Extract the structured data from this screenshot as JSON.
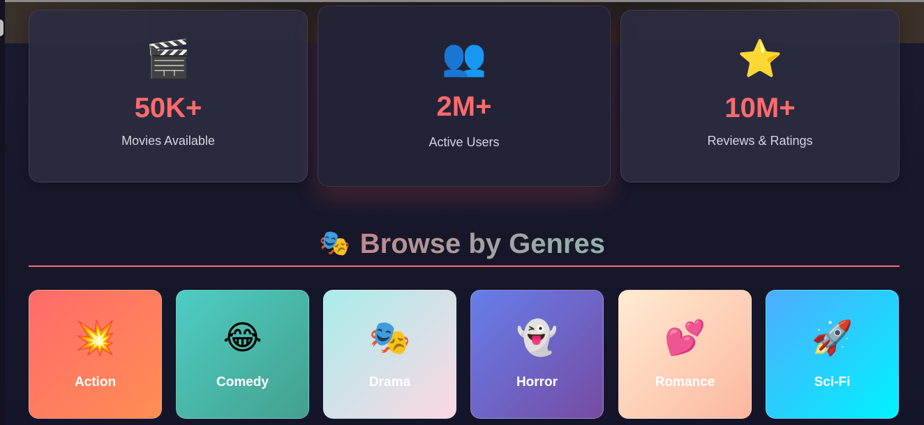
{
  "stats": [
    {
      "icon": "🎬",
      "icon_name": "clapper-board-icon",
      "value": "50K+",
      "label": "Movies Available"
    },
    {
      "icon": "👥",
      "icon_name": "users-icon",
      "value": "2M+",
      "label": "Active Users"
    },
    {
      "icon": "⭐",
      "icon_name": "star-icon",
      "value": "10M+",
      "label": "Reviews & Ratings"
    }
  ],
  "genres_section": {
    "icon": "🎭",
    "icon_name": "theater-masks-icon",
    "title": "Browse by Genres"
  },
  "genres": [
    {
      "icon": "💥",
      "icon_name": "explosion-icon",
      "label": "Action"
    },
    {
      "icon": "😂",
      "icon_name": "laughing-face-icon",
      "label": "Comedy"
    },
    {
      "icon": "🎭",
      "icon_name": "theater-masks-icon",
      "label": "Drama"
    },
    {
      "icon": "👻",
      "icon_name": "ghost-icon",
      "label": "Horror"
    },
    {
      "icon": "💕",
      "icon_name": "hearts-icon",
      "label": "Romance"
    },
    {
      "icon": "🚀",
      "icon_name": "rocket-icon",
      "label": "Sci-Fi"
    }
  ],
  "colors": {
    "accent": "#ff6b6b",
    "background": "#17172a",
    "rule": "#ff6b7a"
  }
}
